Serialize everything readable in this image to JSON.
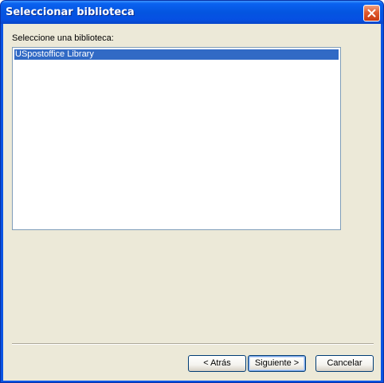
{
  "window": {
    "title": "Seleccionar biblioteca"
  },
  "main": {
    "prompt": "Seleccione una biblioteca:",
    "libraries": [
      {
        "label": "USpostoffice Library",
        "selected": true
      }
    ]
  },
  "buttons": {
    "back_label": "< Atrás",
    "next_label": "Siguiente >",
    "cancel_label": "Cancelar"
  },
  "icons": {
    "close": "close-icon"
  },
  "colors": {
    "title_bar": "#0a54e3",
    "selection": "#316ac5",
    "dialog_face": "#ece9d8",
    "close_button": "#e05a2e"
  }
}
